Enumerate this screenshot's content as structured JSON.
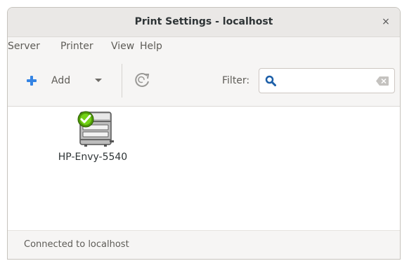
{
  "window": {
    "title": "Print Settings - localhost",
    "close_icon": "×"
  },
  "menu": [
    "Server",
    "Printer",
    "View",
    "Help"
  ],
  "toolbar": {
    "add_label": "Add",
    "add_icon": "plus-icon",
    "dropdown_icon": "chevron-down-icon",
    "refresh_icon": "refresh-icon",
    "filter_label": "Filter:",
    "filter_value": "",
    "search_icon": "search-icon",
    "clear_icon": "clear-icon"
  },
  "printers": [
    {
      "name": "HP-Envy-5540",
      "status_icon": "checkmark-icon"
    }
  ],
  "status": {
    "text": "Connected to localhost"
  },
  "colors": {
    "accent_blue": "#3584e4",
    "status_green": "#4e9a06"
  }
}
